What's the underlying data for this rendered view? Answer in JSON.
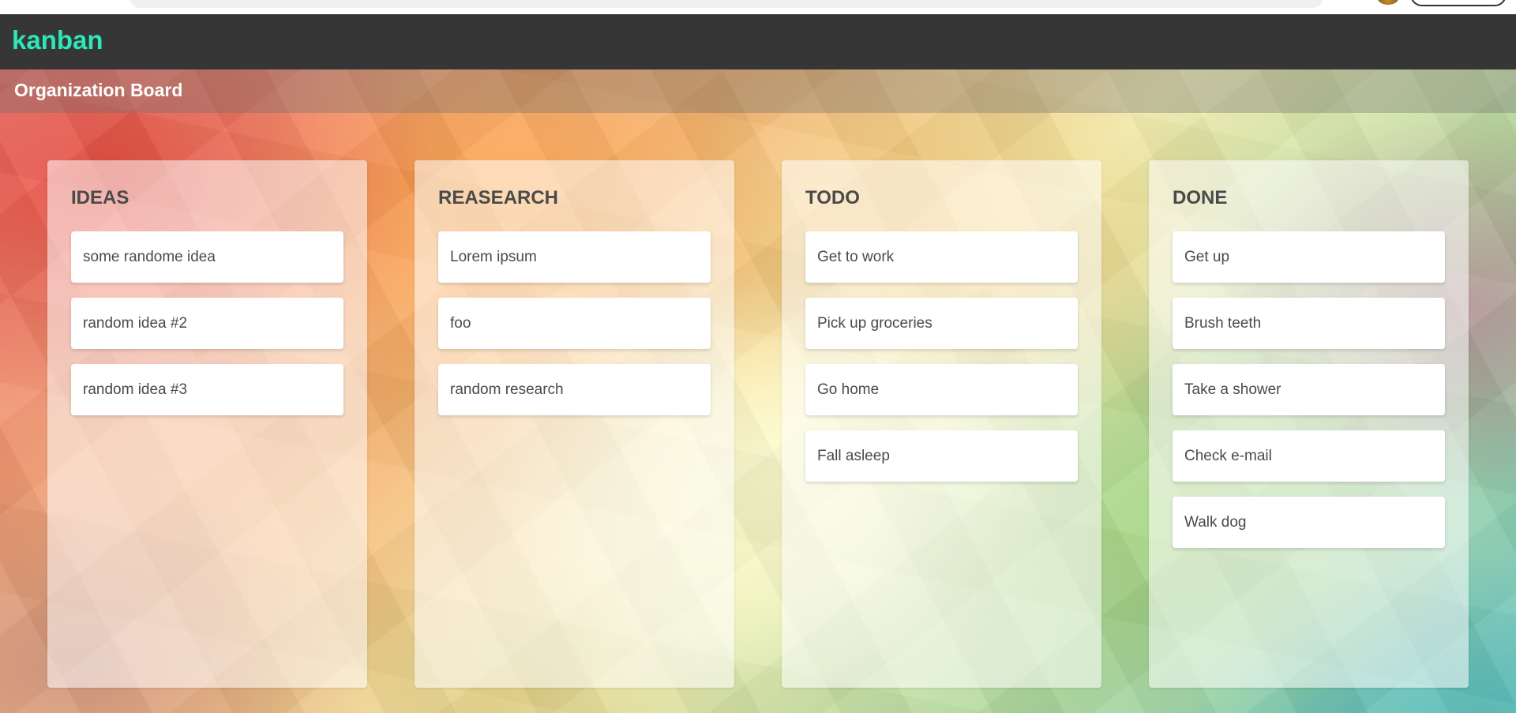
{
  "app": {
    "logo": "kanban"
  },
  "board": {
    "title": "Organization Board"
  },
  "columns": [
    {
      "title": "IDEAS",
      "cards": [
        "some randome idea",
        "random idea #2",
        "random idea #3"
      ]
    },
    {
      "title": "REASEARCH",
      "cards": [
        "Lorem ipsum",
        "foo",
        "random research"
      ]
    },
    {
      "title": "TODO",
      "cards": [
        "Get to work",
        "Pick up groceries",
        "Go home",
        "Fall asleep"
      ]
    },
    {
      "title": "DONE",
      "cards": [
        "Get up",
        "Brush teeth",
        "Take a shower",
        "Check e-mail",
        "Walk dog"
      ]
    }
  ],
  "colors": {
    "header_bg": "#363636",
    "logo": "#2ee6b6",
    "card_text": "#4a4a4a"
  }
}
